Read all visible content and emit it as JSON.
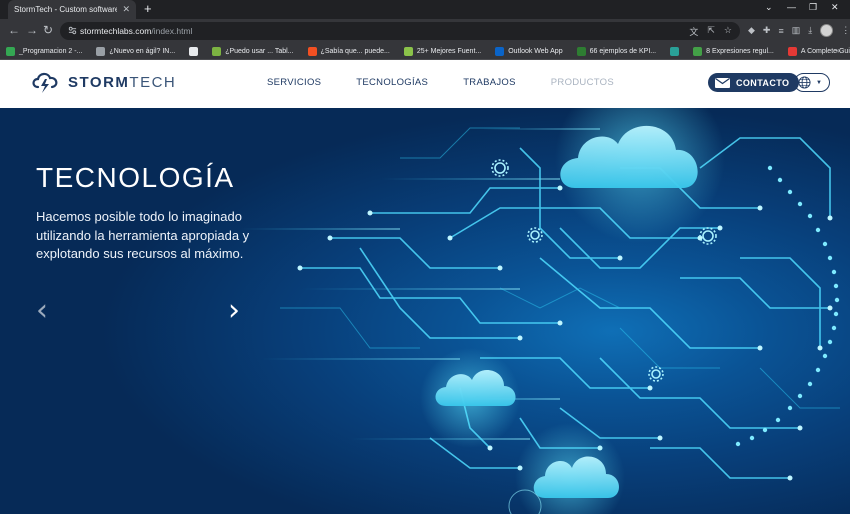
{
  "browser": {
    "tab_title": "StormTech - Custom software de",
    "url_host": "stormtechlabs.com",
    "url_path": "/index.html",
    "bookmarks": [
      {
        "label": "_Programacion 2 -...",
        "color": "#34a853"
      },
      {
        "label": "¿Nuevo en ágil? IN...",
        "color": "#9aa0a6"
      },
      {
        "label": "",
        "color": "#e8eaed"
      },
      {
        "label": "¿Puedo usar ... Tabl...",
        "color": "#7cb342"
      },
      {
        "label": "¿Sabía que... puede...",
        "color": "#f25022"
      },
      {
        "label": "25+ Mejores Fuent...",
        "color": "#8bc34a"
      },
      {
        "label": "Outlook Web App",
        "color": "#0a64c8"
      },
      {
        "label": "66 ejemplos de KPI...",
        "color": "#2e7d32"
      },
      {
        "label": "",
        "color": "#2aa198"
      },
      {
        "label": "8 Expresiones regul...",
        "color": "#43a047"
      },
      {
        "label": "A Complete Guide t...",
        "color": "#e53935"
      }
    ]
  },
  "site": {
    "logo": {
      "bold": "STORM",
      "light": "TECH"
    },
    "nav": [
      "SERVICIOS",
      "TECNOLOGÍAS",
      "TRABAJOS",
      "PRODUCTOS"
    ],
    "contact_label": "CONTACTO",
    "hero": {
      "title": "TECNOLOGÍA",
      "text": "Hacemos posible todo lo imaginado utilizando la herramienta apropiada y explotando sus recursos al máximo."
    }
  },
  "colors": {
    "brand": "#1f3a63",
    "hero_bg": "#083f7a",
    "accent": "#1fd6f5"
  }
}
